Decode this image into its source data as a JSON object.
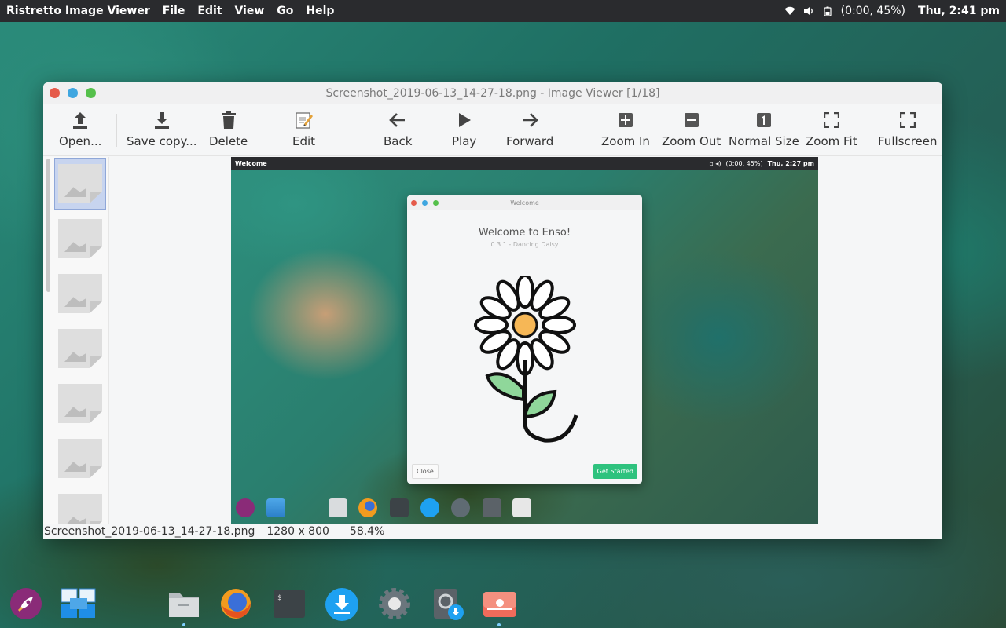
{
  "top_panel": {
    "app_name": "Ristretto Image Viewer",
    "menus": [
      "File",
      "Edit",
      "View",
      "Go",
      "Help"
    ],
    "battery": "(0:00, 45%)",
    "clock": "Thu,  2:41 pm",
    "icons": [
      "wifi-icon",
      "volume-icon",
      "battery-icon"
    ]
  },
  "window": {
    "title": "Screenshot_2019-06-13_14-27-18.png - Image Viewer [1/18]",
    "toolbar": {
      "open": "Open...",
      "save_copy": "Save copy...",
      "delete": "Delete",
      "edit": "Edit",
      "back": "Back",
      "play": "Play",
      "forward": "Forward",
      "zoom_in": "Zoom In",
      "zoom_out": "Zoom Out",
      "normal_size": "Normal Size",
      "zoom_fit": "Zoom Fit",
      "fullscreen": "Fullscreen"
    },
    "thumbnails_count": 7,
    "status": {
      "filename": "Screenshot_2019-06-13_14-27-18.png",
      "dimensions": "1280 x 800",
      "zoom": "58.4%"
    }
  },
  "screenshot": {
    "panel_title": "Welcome",
    "battery": "(0:00, 45%)",
    "clock": "Thu,  2:27 pm",
    "welcome": {
      "window_title": "Welcome",
      "heading": "Welcome to Enso!",
      "subheading": "0.3.1 - Dancing Daisy",
      "close": "Close",
      "get_started": "Get Started"
    }
  },
  "colors": {
    "panel": "#2a2b2e",
    "accent_green": "#2ec27e",
    "close": "#e55b4b",
    "minimize": "#3fa6e0",
    "maximize": "#55c04b",
    "selection": "#c7d4ef"
  }
}
